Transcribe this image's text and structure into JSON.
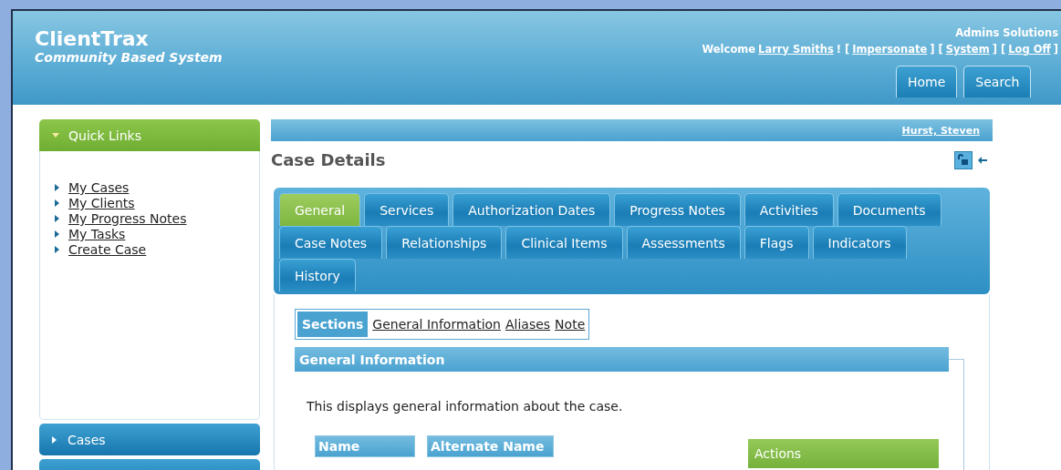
{
  "header": {
    "app_name": "ClientTrax",
    "subtitle": "Community Based System",
    "org": "Admins Solutions",
    "welcome_line": [
      {
        "kind": "text",
        "text": "Welcome"
      },
      {
        "kind": "link",
        "text": "Larry Smiths"
      },
      {
        "kind": "text",
        "text": "! ["
      },
      {
        "kind": "link",
        "text": "Impersonate"
      },
      {
        "kind": "text",
        "text": "] ["
      },
      {
        "kind": "link",
        "text": "System"
      },
      {
        "kind": "text",
        "text": "] ["
      },
      {
        "kind": "link",
        "text": "Log Off"
      },
      {
        "kind": "text",
        "text": "]"
      }
    ],
    "nav": [
      {
        "label": "Home"
      },
      {
        "label": "Search"
      }
    ]
  },
  "sidebar": {
    "quick_links": {
      "title": "Quick Links",
      "expanded": true,
      "items": [
        "My Cases",
        "My Clients",
        "My Progress Notes",
        "My Tasks",
        "Create Case"
      ]
    },
    "panels": [
      {
        "title": "Cases",
        "expanded": false
      }
    ]
  },
  "client_bar": {
    "client": "Hurst, Steven"
  },
  "page_title": "Case Details",
  "tabs": [
    [
      {
        "label": "General",
        "selected": true
      },
      {
        "label": "Services",
        "selected": false
      },
      {
        "label": "Authorization Dates",
        "selected": false
      },
      {
        "label": "Progress Notes",
        "selected": false
      },
      {
        "label": "Activities",
        "selected": false
      },
      {
        "label": "Documents",
        "selected": false
      }
    ],
    [
      {
        "label": "Case Notes",
        "selected": false
      },
      {
        "label": "Relationships",
        "selected": false
      },
      {
        "label": "Clinical Items",
        "selected": false
      },
      {
        "label": "Assessments",
        "selected": false
      },
      {
        "label": "Flags",
        "selected": false
      },
      {
        "label": "Indicators",
        "selected": false
      }
    ],
    [
      {
        "label": "History",
        "selected": false
      }
    ]
  ],
  "sections": {
    "label": "Sections",
    "links": [
      "General Information",
      "Aliases",
      "Note"
    ]
  },
  "general_information": {
    "title": "General Information",
    "description": "This displays general information about the case.",
    "columns": [
      "Name",
      "Alternate Name"
    ]
  },
  "actions": {
    "title": "Actions"
  }
}
